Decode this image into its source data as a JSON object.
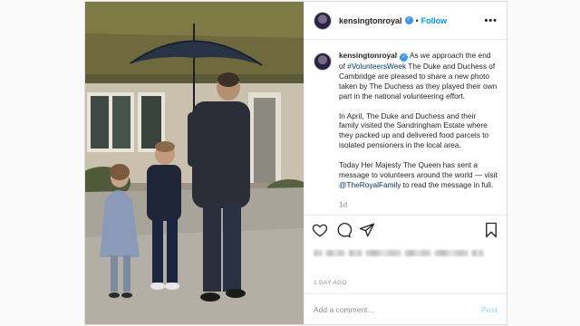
{
  "post": {
    "username": "kensingtonroyal",
    "follow_label": "Follow",
    "separator": "•",
    "more_label": "•••",
    "caption": {
      "username": "kensingtonroyal",
      "p1_before": " As we approach the end of ",
      "hashtag": "#VolunteersWeek",
      "p1_after": " The Duke and Duchess of Cambridge are pleased to share a new photo taken by The Duchess as they played their own part in the national volunteering effort.",
      "p2": "In April, The Duke and Duchess and their family visited the Sandringham Estate where they packed up and delivered food parcels to isolated pensioners in the local area.",
      "p3_before": "Today Her Majesty The Queen has sent a message to volunteers around the world — visit ",
      "mention": "@TheRoyalFamily",
      "p3_after": " to read the message in full.",
      "truncated": "1d"
    },
    "icons": [
      "heart-icon",
      "comment-icon",
      "share-icon",
      "bookmark-icon"
    ],
    "timestamp": "1 DAY AGO",
    "comment_placeholder": "Add a comment...",
    "post_label": "Post"
  },
  "colors": {
    "link_blue": "#0095f6",
    "verified_blue": "#3897f0",
    "post_disabled": "#b3dbff"
  }
}
